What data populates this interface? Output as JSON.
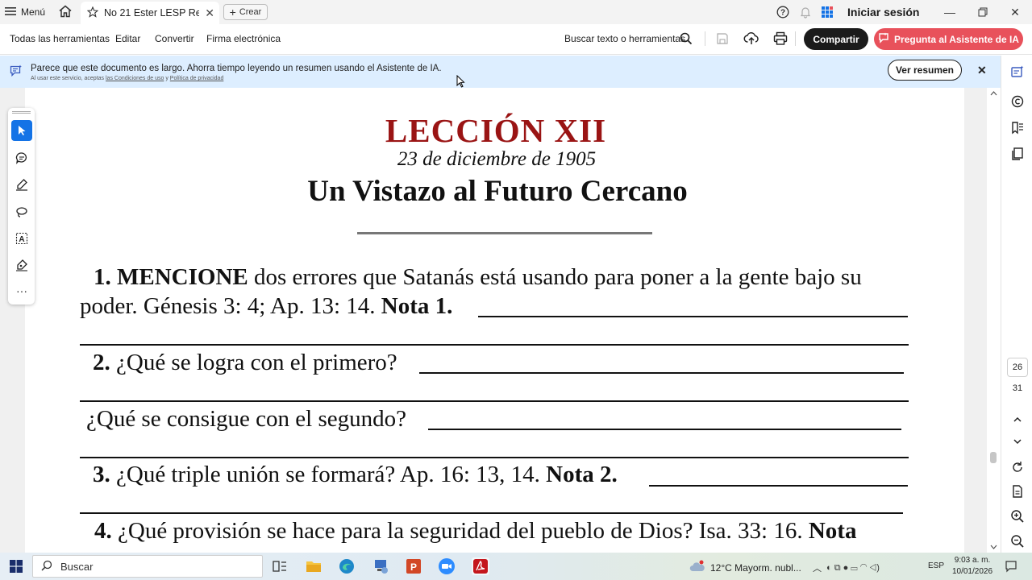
{
  "titlebar": {
    "menu_label": "Menú",
    "tab_title": "No 21 Ester LESP Re...",
    "create_label": "Crear",
    "signin_label": "Iniciar sesión"
  },
  "toolbar": {
    "items": [
      "Todas las herramientas",
      "Editar",
      "Convertir",
      "Firma electrónica"
    ],
    "search_label": "Buscar texto o herramientas",
    "share_label": "Compartir",
    "ai_label": "Pregunta al Asistente de IA"
  },
  "banner": {
    "text": "Parece que este documento es largo. Ahorra tiempo leyendo un resumen usando el Asistente de IA.",
    "sub_prefix": "Al usar este servicio, aceptas",
    "sub_link1": "las Condiciones de uso",
    "sub_and": "y",
    "sub_link2": "Política de privacidad",
    "button_label": "Ver resumen"
  },
  "navigation": {
    "current_page": "26",
    "total_pages": "31"
  },
  "document": {
    "lesson": "LECCIÓN XII",
    "date": "23 de diciembre de 1905",
    "title": "Un Vistazo al Futuro Cercano",
    "q1_num": "1.",
    "q1_bold": "MENCIONE",
    "q1_text": "dos errores que Satanás está usando para poner a la gente bajo su",
    "q1_line2": "poder. Génesis 3: 4; Ap. 13: 14.",
    "q1_note": "Nota 1.",
    "q2_num": "2.",
    "q2_text": "¿Qué se logra con el primero?",
    "q2b_text": "¿Qué se consigue con el segundo?",
    "q3_num": "3.",
    "q3_text": "¿Qué triple unión se formará? Ap. 16: 13, 14.",
    "q3_note": "Nota 2.",
    "q4_num": "4.",
    "q4_text": "¿Qué provisión se hace para la seguridad del pueblo de Dios? Isa. 33: 16.",
    "q4_note": "Nota"
  },
  "taskbar": {
    "search_placeholder": "Buscar",
    "weather": "12°C  Mayorm. nubl...",
    "lang": "ESP",
    "time": "9:03 a. m.",
    "date": "10/01/2026"
  }
}
